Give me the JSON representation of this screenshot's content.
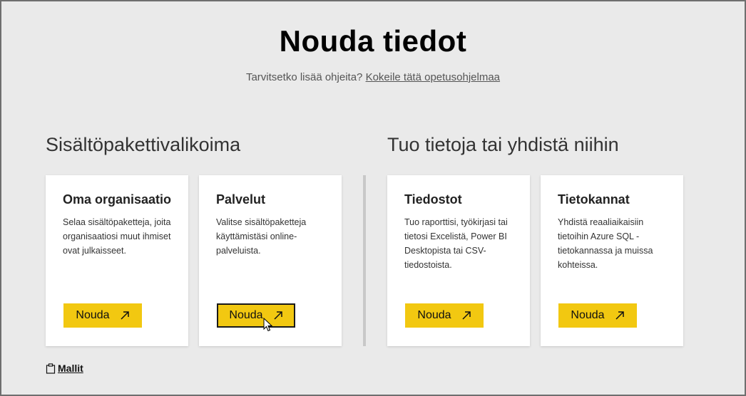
{
  "header": {
    "title": "Nouda tiedot",
    "help_text": "Tarvitsetko lisää ohjeita?",
    "help_link": "Kokeile tätä opetusohjelmaa"
  },
  "sections": {
    "left_title": "Sisältöpakettivalikoima",
    "right_title": "Tuo tietoja tai yhdistä niihin"
  },
  "cards": [
    {
      "title": "Oma organisaatio",
      "desc": "Selaa sisältöpaketteja, joita organisaatiosi muut ihmiset ovat julkaisseet.",
      "button": "Nouda"
    },
    {
      "title": "Palvelut",
      "desc": "Valitse sisältöpaketteja käyttämistäsi online-palveluista.",
      "button": "Nouda"
    },
    {
      "title": "Tiedostot",
      "desc": "Tuo raporttisi, työkirjasi tai tietosi Excelistä, Power BI Desktopista tai CSV-tiedostoista.",
      "button": "Nouda"
    },
    {
      "title": "Tietokannat",
      "desc": "Yhdistä reaaliaikaisiin tietoihin Azure SQL -tietokannassa ja muissa kohteissa.",
      "button": "Nouda"
    }
  ],
  "footer": {
    "templates_label": "Mallit"
  },
  "colors": {
    "accent": "#f2c811",
    "background": "#eaeaea"
  },
  "icons": {
    "button_arrow": "arrow-up-right-icon",
    "templates": "clipboard-icon",
    "cursor": "mouse-pointer-icon"
  }
}
